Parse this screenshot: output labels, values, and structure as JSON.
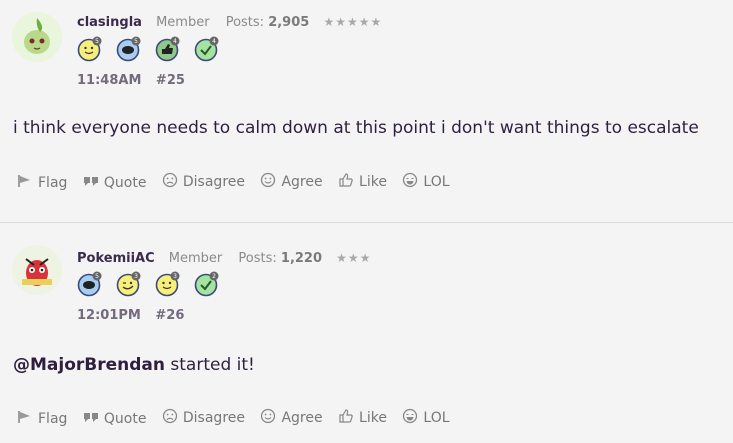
{
  "posts": [
    {
      "username": "clasingla",
      "role": "Member",
      "posts_label": "Posts:",
      "posts_count": "2,905",
      "stars": "★★★★★",
      "badges": [
        "5",
        "5",
        "4",
        "4"
      ],
      "time": "11:48AM",
      "number": "#25",
      "body": "i think everyone needs to calm down at this point i don't want things to escalate"
    },
    {
      "username": "PokemiiAC",
      "role": "Member",
      "posts_label": "Posts:",
      "posts_count": "1,220",
      "stars": "★★★",
      "badges": [
        "5",
        "3",
        "3",
        "2"
      ],
      "time": "12:01PM",
      "number": "#26",
      "mention": "@MajorBrendan",
      "body_rest": " started it!"
    }
  ],
  "actions": {
    "flag": "Flag",
    "quote": "Quote",
    "disagree": "Disagree",
    "agree": "Agree",
    "like": "Like",
    "lol": "LOL"
  }
}
